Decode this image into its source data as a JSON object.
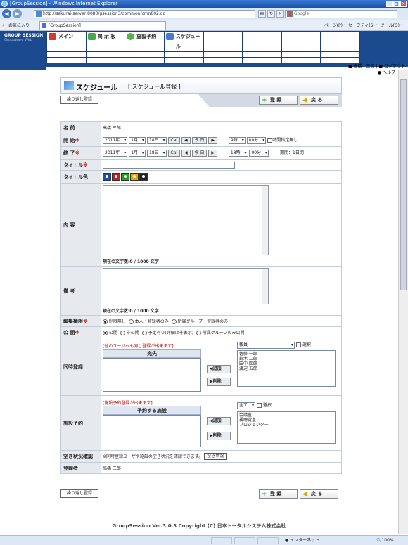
{
  "browser": {
    "title": "[GroupSession] - Windows Internet Explorer",
    "url": "http://sakurai-server:8080/gsession3/common/cmn802.do",
    "search_placeholder": "Google",
    "fav_label": "お気に入り",
    "tab_label": "[GroupSession]",
    "tools": "ページ(P)・ セーフティ(S)・ ツール(O)・"
  },
  "app": {
    "logo": "GROUP SESSION",
    "logo_sub": "Groupware Web",
    "menu": [
      "メイン",
      "掲 示 板",
      "施設予約",
      "スケジュール"
    ],
    "user": "高橋　三郎",
    "logout": "ログアウト",
    "help": "ヘルプ"
  },
  "page": {
    "title": "スケジュール",
    "subtitle": "[ スケジュール登録 ]",
    "repeat_button": "繰り返し登録",
    "register_button": "登 録",
    "back_button": "戻 る"
  },
  "form": {
    "name_label": "名 前",
    "name_value": "高橋 三郎",
    "start_label": "開 始",
    "end_label": "終 了",
    "start": {
      "year": "2011年",
      "month": "1月",
      "day": "18日",
      "hour": "9時",
      "minute": "00分"
    },
    "end": {
      "year": "2011年",
      "month": "1月",
      "day": "18日",
      "hour": "18時",
      "minute": "00分"
    },
    "cal_label": "Cal",
    "today_label": "今 日",
    "no_time_label": "時間指定無し",
    "duration": "期間：1日間",
    "title_label": "タイトル",
    "title_color_label": "タイトル色",
    "title_colors": [
      "#1a4fbf",
      "#d21919",
      "#18a818",
      "#f0a000",
      "#222222"
    ],
    "content_label": "内 容",
    "content_count": "現在の文字数:0 / 1000 文字",
    "memo_label": "備 考",
    "memo_count": "現在の文字数:0 / 1000 文字",
    "edit_label": "編集権限",
    "edit_options": [
      "制限無し",
      "本人・登録者のみ",
      "所属グループ・登録者のみ"
    ],
    "public_label": "公 開",
    "public_options": [
      "公開",
      "非公開",
      "予定有り(詳細は非表示)",
      "所属グループのみ公開"
    ],
    "share_label": "同時登録",
    "share_note": "[他のユーザへも同じ登録が出来ます]",
    "share_header": "宛先",
    "share_group": "教員",
    "share_select_all": "選択",
    "share_users": [
      "佐藤 一郎",
      "鈴木 二郎",
      "田中 四郎",
      "渡辺 五郎"
    ],
    "add_label": "追加",
    "delete_label": "削除",
    "facility_label": "施設予約",
    "facility_note": "[施設予約登録が出来ます]",
    "facility_header": "予約する施設",
    "facility_group": "全て",
    "facility_select_all": "選択",
    "facilities": [
      "会議室",
      "視聴覚室",
      "プロジェクター"
    ],
    "avail_label": "空き状況確認",
    "avail_note": "※同時登録ユーザや施設の空き状況を確認できます。",
    "avail_button": "空き状況",
    "registrant_label": "登録者",
    "registrant_value": "高橋 三郎"
  },
  "footer": {
    "copyright": "GroupSession Ver.3.0.3 Copyright (C) 日本トータルシステム株式会社"
  },
  "status": {
    "zone": "インターネット",
    "zoom": "100%"
  }
}
